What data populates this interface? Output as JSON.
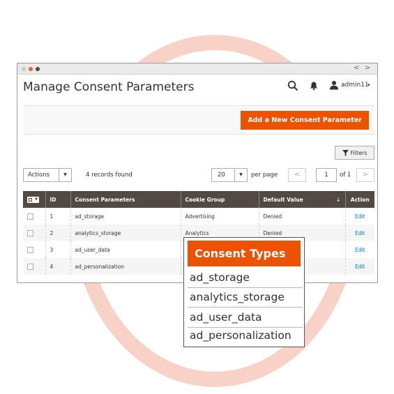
{
  "window": {
    "nav_arrows": "< >"
  },
  "header": {
    "title": "Manage Consent Parameters",
    "user_name": "admin11",
    "user_caret": "▾"
  },
  "toolbar": {
    "add_button_label": "Add a New Consent Parameter",
    "filters_label": "Filters",
    "actions_label": "Actions",
    "records_found": "4 records found",
    "per_page_value": "20",
    "per_page_label": "per page",
    "prev_label": "<",
    "page_value": "1",
    "of_label": "of 1",
    "next_label": ">"
  },
  "grid": {
    "headers": {
      "id": "ID",
      "param": "Consent Parameters",
      "group": "Cookie Group",
      "default": "Default Value",
      "sort_arrow": "↓",
      "action": "Action"
    },
    "rows": [
      {
        "id": "1",
        "param": "ad_storage",
        "group": "Advertising",
        "default": "Denied",
        "action": "Edit"
      },
      {
        "id": "2",
        "param": "analytics_storage",
        "group": "Analytics",
        "default": "Denied",
        "action": "Edit"
      },
      {
        "id": "3",
        "param": "ad_user_data",
        "group": "",
        "default": "",
        "action": "Edit"
      },
      {
        "id": "4",
        "param": "ad_personalization",
        "group": "",
        "default": "",
        "action": "Edit"
      }
    ]
  },
  "overlay": {
    "title": "Consent Types",
    "items": [
      "ad_storage",
      "analytics_storage",
      "ad_user_data",
      "ad_personalization"
    ]
  },
  "colors": {
    "accent": "#eb5202",
    "grid_header": "#514943",
    "link": "#007bdb",
    "ring": "#f9d2c7"
  }
}
